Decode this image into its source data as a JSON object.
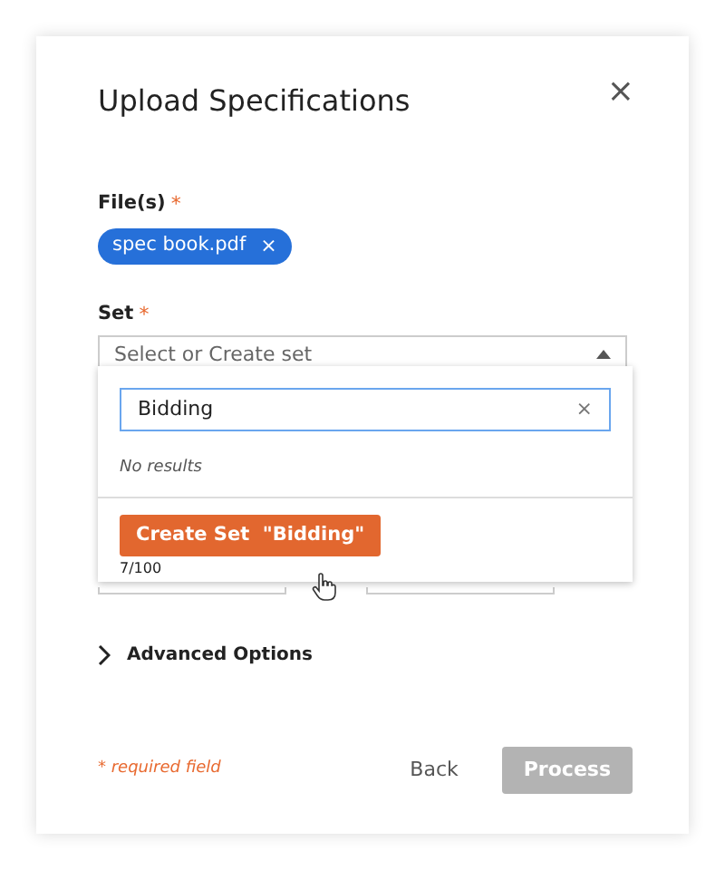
{
  "dialog": {
    "title": "Upload Specifications",
    "close": "×"
  },
  "files": {
    "label": "File(s)",
    "required_mark": "*",
    "chips": [
      {
        "name": "spec book.pdf",
        "remove": "×"
      }
    ]
  },
  "set": {
    "label": "Set",
    "required_mark": "*",
    "placeholder": "Select or Create set",
    "expanded": true,
    "dropdown": {
      "search": "Bidding",
      "clear": "×",
      "message": "No results",
      "create_label": "Create Set",
      "create_value": "\"Bidding\"",
      "counter": "7/100"
    }
  },
  "advanced": {
    "label": "Advanced Options",
    "expanded": false
  },
  "footer": {
    "required_note": "* required field",
    "buttons": [
      {
        "label": "Back",
        "kind": "link"
      },
      {
        "label": "Process",
        "kind": "primary",
        "disabled": true
      }
    ]
  }
}
